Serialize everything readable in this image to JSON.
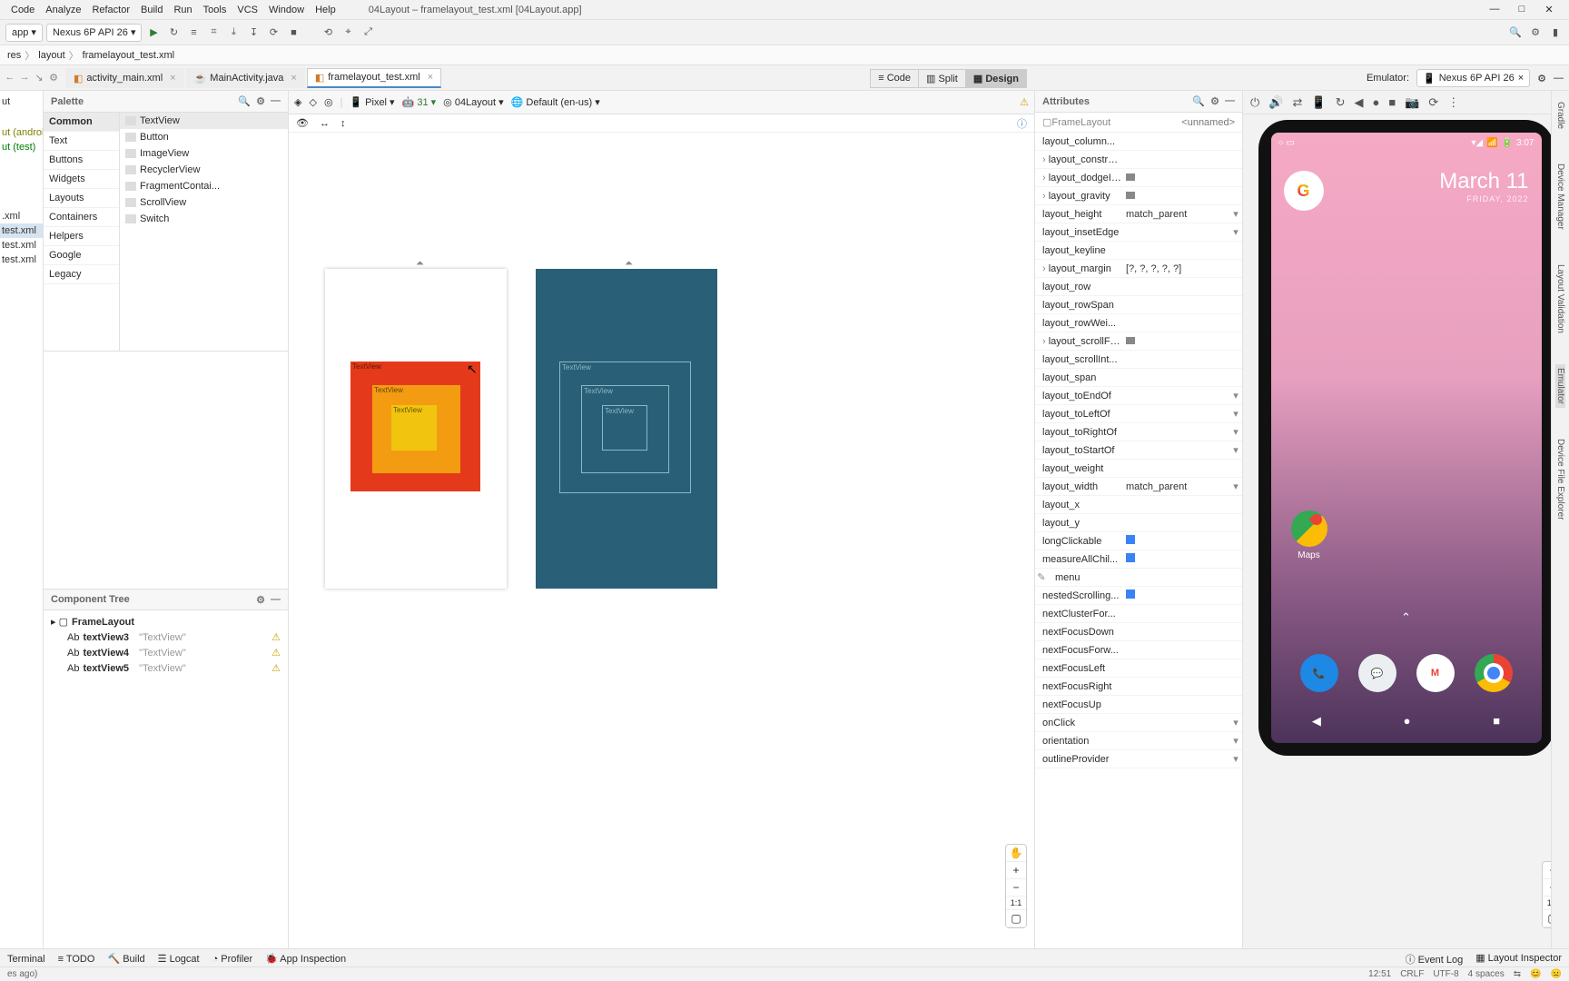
{
  "window": {
    "title": "04Layout – framelayout_test.xml [04Layout.app]",
    "min": "—",
    "max": "□",
    "close": "✕"
  },
  "menubar": [
    "Code",
    "Analyze",
    "Refactor",
    "Build",
    "Run",
    "Tools",
    "VCS",
    "Window",
    "Help"
  ],
  "toolbar": {
    "module": "app ▾",
    "device": "Nexus 6P API 26 ▾",
    "icons": [
      "▶",
      "↻",
      "≡",
      "⌗",
      "⤓",
      "↧",
      "⟳",
      "■",
      "",
      "⟲",
      "⌖",
      "⤢"
    ]
  },
  "breadcrumb": [
    "res",
    "layout",
    "framelayout_test.xml"
  ],
  "editorTabs": {
    "left_arrows": [
      "←",
      "→",
      "↘",
      "⚙"
    ],
    "tabs": [
      {
        "label": "activity_main.xml",
        "icon": "◧",
        "active": false
      },
      {
        "label": "MainActivity.java",
        "icon": "☕",
        "active": false
      },
      {
        "label": "framelayout_test.xml",
        "icon": "◧",
        "active": true
      }
    ],
    "emulator_label": "Emulator:",
    "emulator_device": "Nexus 6P API 26",
    "emulator_close": "×",
    "settings": "⚙",
    "minus": "—"
  },
  "projectPane": {
    "items": [
      {
        "t": "ut",
        "cls": ""
      },
      {
        "t": "ut (androidTest)",
        "cls": "and"
      },
      {
        "t": "ut (test)",
        "cls": "test"
      },
      {
        "t": ".xml",
        "cls": ""
      },
      {
        "t": "test.xml",
        "cls": "sel"
      },
      {
        "t": "test.xml",
        "cls": ""
      },
      {
        "t": "test.xml",
        "cls": ""
      }
    ]
  },
  "palette": {
    "title": "Palette",
    "tools": [
      "🔍",
      "⚙",
      "—"
    ],
    "categories": [
      "Common",
      "Text",
      "Buttons",
      "Widgets",
      "Layouts",
      "Containers",
      "Helpers",
      "Google",
      "Legacy"
    ],
    "active_cat": "Common",
    "items": [
      {
        "l": "TextView",
        "ic": "Ab",
        "active": true
      },
      {
        "l": "Button",
        "ic": "▭"
      },
      {
        "l": "ImageView",
        "ic": "▣"
      },
      {
        "l": "RecyclerView",
        "ic": "≡"
      },
      {
        "l": "FragmentContai...",
        "ic": "▦"
      },
      {
        "l": "ScrollView",
        "ic": "≣"
      },
      {
        "l": "Switch",
        "ic": "◐"
      }
    ]
  },
  "designToolbar": {
    "items": [
      "◈",
      "◇",
      "◎",
      "|",
      "📱 Pixel ▾",
      "🤖 31 ▾",
      "◎ 04Layout ▾",
      "🌐 Default (en-us) ▾"
    ],
    "warn": "⚠",
    "preview_row": [
      "👁",
      "↔",
      "↕",
      "",
      "ⓘ"
    ]
  },
  "viewTabs": [
    {
      "l": "≡ Code"
    },
    {
      "l": "▥ Split"
    },
    {
      "l": "▦ Design",
      "active": true
    }
  ],
  "surfaces": {
    "tv_label": "TextView"
  },
  "zoom": {
    "hand": "✋",
    "plus": "+",
    "minus": "−",
    "one": "1:1",
    "fit": "▢"
  },
  "attributes": {
    "title": "Attributes",
    "tools": [
      "🔍",
      "⚙",
      "—"
    ],
    "component": "FrameLayout",
    "component_id": "<unnamed>",
    "rows": [
      {
        "k": "layout_column...",
        "v": ""
      },
      {
        "k": "layout_constrai...",
        "v": "",
        "exp": true
      },
      {
        "k": "layout_dodgeIn...",
        "v": "flag",
        "exp": true
      },
      {
        "k": "layout_gravity",
        "v": "flag",
        "exp": true
      },
      {
        "k": "layout_height",
        "v": "match_parent",
        "dd": true
      },
      {
        "k": "layout_insetEdge",
        "v": "",
        "dd": true
      },
      {
        "k": "layout_keyline",
        "v": ""
      },
      {
        "k": "layout_margin",
        "v": "[?, ?, ?, ?, ?]",
        "exp": true
      },
      {
        "k": "layout_row",
        "v": ""
      },
      {
        "k": "layout_rowSpan",
        "v": ""
      },
      {
        "k": "layout_rowWei...",
        "v": ""
      },
      {
        "k": "layout_scrollFla...",
        "v": "flag",
        "exp": true
      },
      {
        "k": "layout_scrollInt...",
        "v": ""
      },
      {
        "k": "layout_span",
        "v": ""
      },
      {
        "k": "layout_toEndOf",
        "v": "",
        "dd": true
      },
      {
        "k": "layout_toLeftOf",
        "v": "",
        "dd": true
      },
      {
        "k": "layout_toRightOf",
        "v": "",
        "dd": true
      },
      {
        "k": "layout_toStartOf",
        "v": "",
        "dd": true
      },
      {
        "k": "layout_weight",
        "v": ""
      },
      {
        "k": "layout_width",
        "v": "match_parent",
        "dd": true
      },
      {
        "k": "layout_x",
        "v": ""
      },
      {
        "k": "layout_y",
        "v": ""
      },
      {
        "k": "longClickable",
        "v": "tri"
      },
      {
        "k": "measureAllChil...",
        "v": "tri"
      },
      {
        "k": "menu",
        "v": "",
        "wr": true
      },
      {
        "k": "nestedScrolling...",
        "v": "tri"
      },
      {
        "k": "nextClusterFor...",
        "v": ""
      },
      {
        "k": "nextFocusDown",
        "v": ""
      },
      {
        "k": "nextFocusForw...",
        "v": ""
      },
      {
        "k": "nextFocusLeft",
        "v": ""
      },
      {
        "k": "nextFocusRight",
        "v": ""
      },
      {
        "k": "nextFocusUp",
        "v": ""
      },
      {
        "k": "onClick",
        "v": "",
        "dd": true
      },
      {
        "k": "orientation",
        "v": "",
        "dd": true
      },
      {
        "k": "outlineProvider",
        "v": "",
        "dd": true
      }
    ]
  },
  "componentTree": {
    "title": "Component Tree",
    "tools": [
      "⚙",
      "—"
    ],
    "root": "FrameLayout",
    "children": [
      {
        "id": "textView3",
        "hint": "\"TextView\""
      },
      {
        "id": "textView4",
        "hint": "\"TextView\""
      },
      {
        "id": "textView5",
        "hint": "\"TextView\""
      }
    ],
    "warn": "⚠"
  },
  "emulator": {
    "tools": [
      "⏻",
      "🔊",
      "⇄",
      "📱",
      "↻",
      "◀",
      "●",
      "■",
      "📷",
      "⟳",
      "⋮"
    ],
    "status": {
      "left": [
        "○",
        "▭"
      ],
      "right": [
        "▾◢",
        "📶",
        "🔋",
        "3:07"
      ]
    },
    "date": "March 11",
    "sub": "FRIDAY, 2022",
    "maps": "Maps",
    "nav": [
      "◀",
      "●",
      "■"
    ],
    "apps": [
      {
        "name": "phone",
        "bg": "#1e88e5"
      },
      {
        "name": "messages",
        "bg": "#eceff1"
      },
      {
        "name": "gmail",
        "bg": "#ffffff"
      },
      {
        "name": "chrome",
        "bg": "#ffffff"
      }
    ]
  },
  "rightStrip": [
    "Gradle",
    "Device Manager",
    "Layout Validation",
    "Emulator",
    "Device File Explorer"
  ],
  "bottomBar": {
    "left": [
      "Terminal",
      "≡ TODO",
      "🔨 Build",
      "☰ Logcat",
      "◔ Profiler",
      "🐞 App Inspection"
    ],
    "right": [
      "ⓘ Event Log",
      "▦ Layout Inspector"
    ]
  },
  "statusBar": {
    "left": "es ago)",
    "right": [
      "12:51",
      "CRLF",
      "UTF-8",
      "4 spaces",
      "⇆",
      "😊",
      "😐"
    ]
  }
}
